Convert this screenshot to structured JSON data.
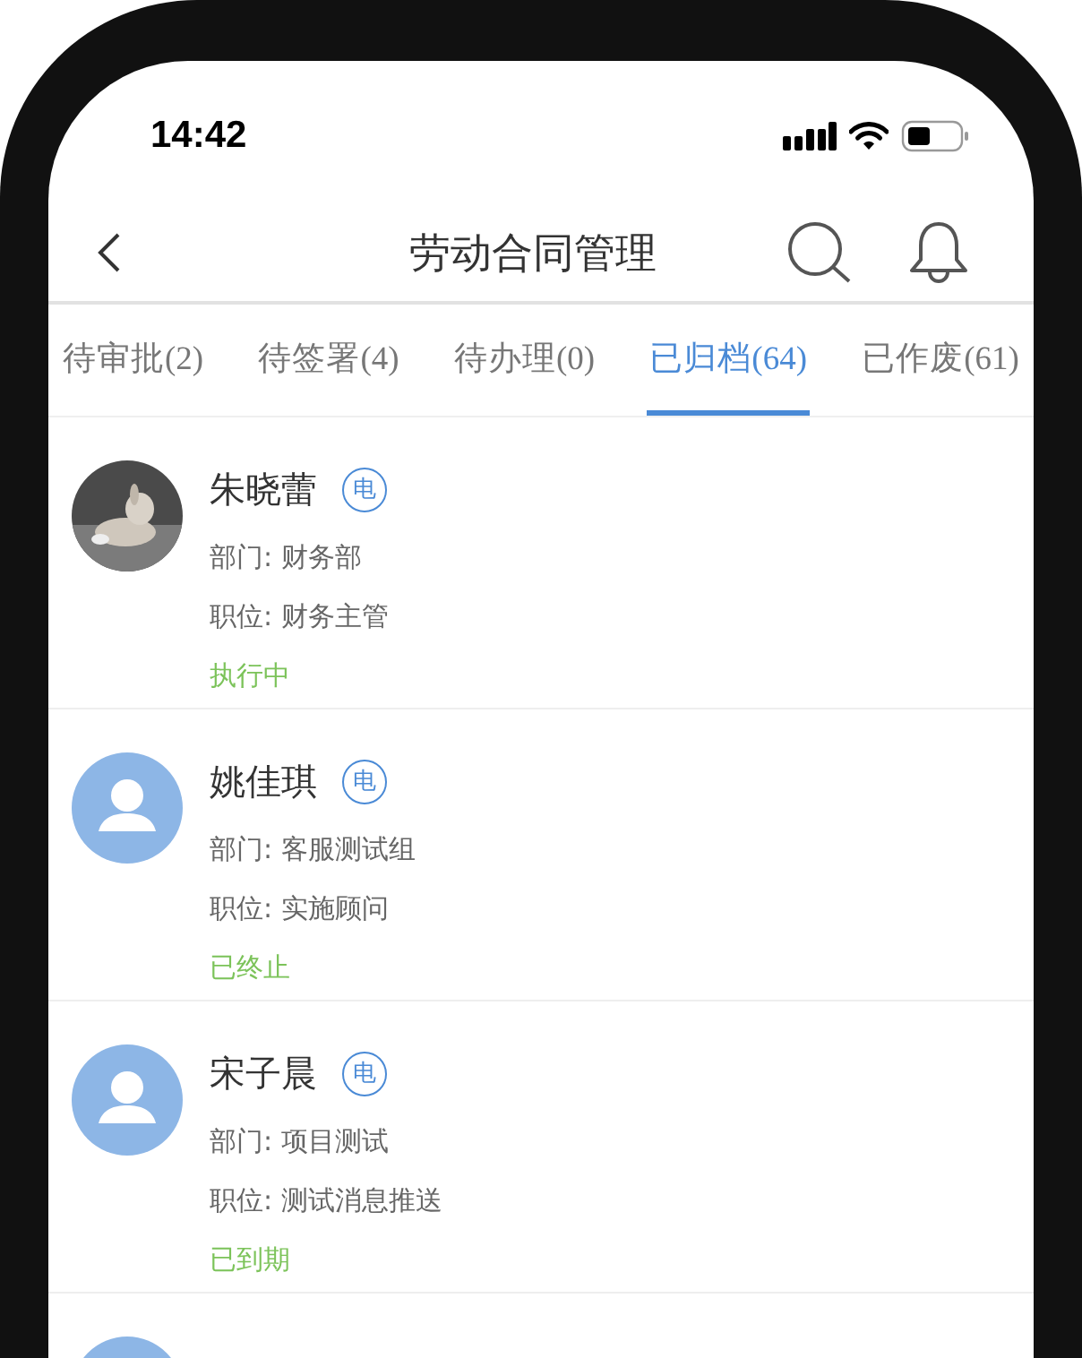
{
  "status_bar": {
    "time": "14:42"
  },
  "nav": {
    "title": "劳动合同管理"
  },
  "tabs": [
    {
      "label": "待审批(2)",
      "selected": false
    },
    {
      "label": "待签署(4)",
      "selected": false
    },
    {
      "label": "待办理(0)",
      "selected": false
    },
    {
      "label": "已归档(64)",
      "selected": true
    },
    {
      "label": "已作废(61)",
      "selected": false
    }
  ],
  "contracts": [
    {
      "name": "朱晓蕾",
      "badge": "电",
      "department": "部门: 财务部",
      "position": "职位: 财务主管",
      "status": "执行中"
    },
    {
      "avatar": {
        "kind": "default"
      },
      "name": "姚佳琪",
      "badge": "电",
      "department": "部门: 客服测试组",
      "position": "职位: 实施顾问",
      "status": "已终止"
    },
    {
      "avatar": {
        "kind": "default"
      },
      "name": "宋子晨",
      "badge": "电",
      "department": "部门: 项目测试",
      "position": "职位: 测试消息推送",
      "status": "已到期"
    },
    {
      "avatar": {
        "kind": "default"
      }
    }
  ]
}
